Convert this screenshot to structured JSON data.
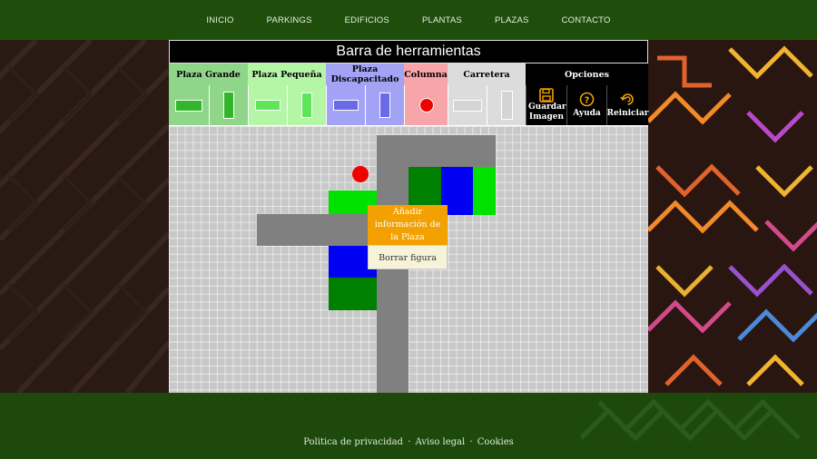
{
  "nav": {
    "items": [
      "INICIO",
      "PARKINGS",
      "EDIFICIOS",
      "PLANTAS",
      "PLAZAS",
      "CONTACTO"
    ]
  },
  "toolbar": {
    "title": "Barra de herramientas",
    "categories": {
      "plaza_grande": "Plaza Grande",
      "plaza_pequena": "Plaza Pequeña",
      "plaza_discapacitado": "Plaza Discapacitado",
      "columna": "Columna",
      "carretera": "Carretera",
      "opciones": "Opciones"
    },
    "options": {
      "save": "Guardar Imagen",
      "help": "Ayuda",
      "reset": "Reiniciar"
    },
    "colors": {
      "plaza_grande": "#8fd68a",
      "plaza_pequena": "#b5f5a6",
      "plaza_discapacitado": "#a3a3f5",
      "columna": "#f7a5a8",
      "carretera": "#dcdcdc",
      "accent": "#f2a100"
    }
  },
  "context_menu": {
    "add_info": "Añadir información de la Plaza",
    "delete": "Borrar figura"
  },
  "footer": {
    "privacy": "Politica de privacidad",
    "legal": "Aviso legal",
    "cookies": "Cookies",
    "separator": "·"
  }
}
